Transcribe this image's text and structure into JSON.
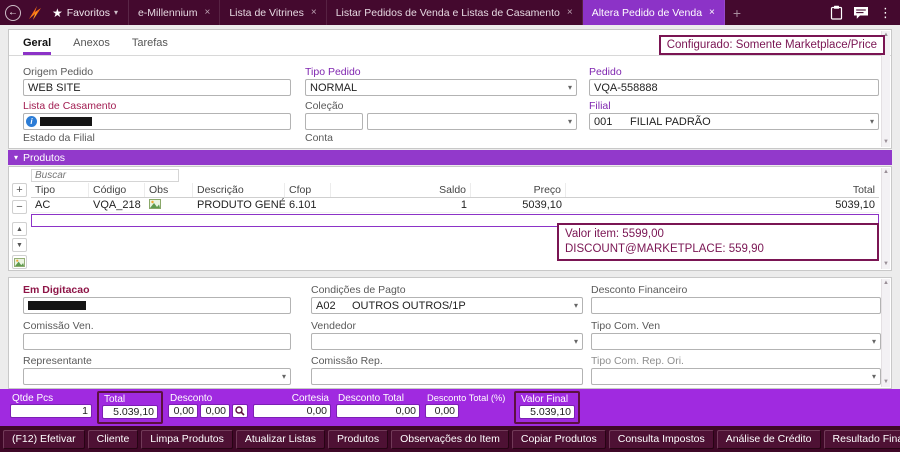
{
  "topbar": {
    "favorites": "Favoritos",
    "tabs": [
      {
        "label": "e-Millennium"
      },
      {
        "label": "Lista de Vitrines"
      },
      {
        "label": "Listar Pedidos de Venda e Listas de Casamento"
      },
      {
        "label": "Altera Pedido de Venda"
      }
    ]
  },
  "page_tabs": {
    "geral": "Geral",
    "anexos": "Anexos",
    "tarefas": "Tarefas"
  },
  "config_note": "Configurado: Somente Marketplace/Price",
  "form": {
    "origem_pedido_label": "Origem Pedido",
    "origem_pedido_value": "WEB SITE",
    "tipo_pedido_label": "Tipo Pedido",
    "tipo_pedido_value": "NORMAL",
    "pedido_label": "Pedido",
    "pedido_value": "VQA-558888",
    "lista_casamento_label": "Lista de Casamento",
    "colecao_label": "Coleção",
    "conta_label": "Conta",
    "filial_label": "Filial",
    "filial_code": "001",
    "filial_value": "FILIAL PADRÃO",
    "estado_filial_label": "Estado da Filial"
  },
  "produtos": {
    "section_title": "Produtos",
    "buscar_placeholder": "Buscar",
    "columns": {
      "tipo": "Tipo",
      "codigo": "Código",
      "obs": "Obs",
      "descricao": "Descrição",
      "cfop": "Cfop",
      "saldo": "Saldo",
      "preco": "Preço",
      "total": "Total"
    },
    "row": {
      "tipo": "AC",
      "codigo": "VQA_218",
      "descricao": "PRODUTO GENÉRI...",
      "cfop": "6.101",
      "saldo": "1",
      "preco": "5039,10",
      "total": "5039,10"
    },
    "note_line1": "Valor item: 5599,00",
    "note_line2": "DISCOUNT@MARKETPLACE: 559,90"
  },
  "payment": {
    "em_digitacao_label": "Em Digitacao",
    "condicoes_label": "Condições de Pagto",
    "condicoes_code": "A02",
    "condicoes_value": "OUTROS OUTROS/1P",
    "desconto_financeiro_label": "Desconto Financeiro",
    "comissao_ven_label": "Comissão Ven.",
    "vendedor_label": "Vendedor",
    "tipo_com_ven_label": "Tipo Com. Ven",
    "representante_label": "Representante",
    "comissao_rep_label": "Comissão Rep.",
    "tipo_com_rep_label": "Tipo Com. Rep. Ori."
  },
  "totals": {
    "qtde_label": "Qtde Pcs",
    "qtde_value": "1",
    "total_label": "Total",
    "total_value": "5.039,10",
    "desconto_label": "Desconto",
    "desconto_v1": "0,00",
    "desconto_v2": "0,00",
    "cortesia_label": "Cortesia",
    "cortesia_value": "0,00",
    "desconto_total_label": "Desconto Total",
    "desconto_total_value": "0,00",
    "desconto_pct_label": "Desconto Total (%)",
    "desconto_pct_value": "0,00",
    "valor_final_label": "Valor Final",
    "valor_final_value": "5.039,10"
  },
  "footer_buttons": [
    "(F12) Efetivar",
    "Cliente",
    "Limpa Produtos",
    "Atualizar Listas",
    "Produtos",
    "Observações do Item",
    "Copiar Produtos",
    "Consulta Impostos",
    "Análise de Crédito",
    "Resultado Financeiro"
  ],
  "icons": {
    "back": "←",
    "star": "★",
    "chevron_down": "▾",
    "close": "×",
    "add_tab": "+",
    "overflow": "⋮",
    "collapse": "▾",
    "select_chevron": "▾",
    "scroll_up": "▲",
    "scroll_down": "▼",
    "add_row": "+",
    "remove_row": "−",
    "row_up": "▲",
    "row_down": "▼",
    "info": "i"
  },
  "colors": {
    "topbar_bg": "#44092e",
    "active_tab": "#8c33c7",
    "section_bar": "#9239cb",
    "totals_bar": "#a02ae0",
    "annotation": "#7a1553",
    "purple_label": "#8027b0",
    "maroon_label": "#a21d52",
    "footer_bg": "#3f0827"
  }
}
